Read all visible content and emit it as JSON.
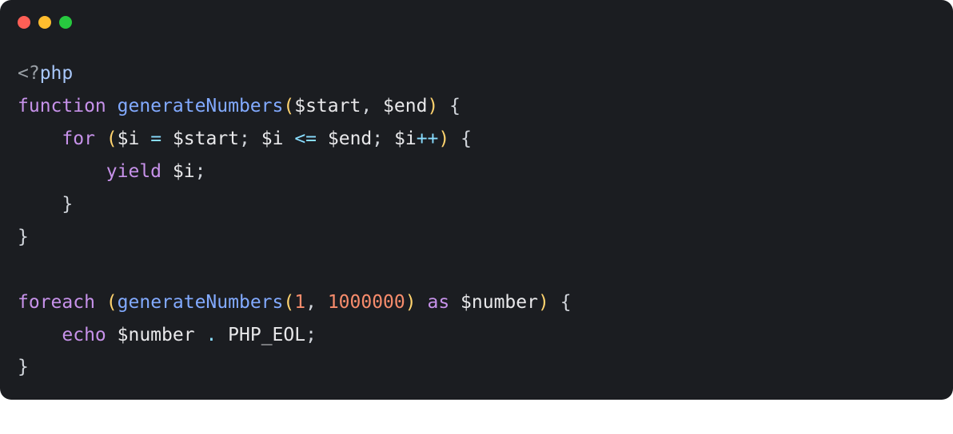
{
  "colors": {
    "background": "#1b1d21",
    "trafficRed": "#ff5f56",
    "trafficYellow": "#ffbd2e",
    "trafficGreen": "#27c93f"
  },
  "code": {
    "l1": {
      "open": "<?",
      "tag": "php"
    },
    "l2": {
      "kw": "function",
      "fn": "generateNumbers",
      "lp": "(",
      "v1": "$start",
      "c1": ",",
      "sp": " ",
      "v2": "$end",
      "rp": ")",
      "sp2": " ",
      "lb": "{"
    },
    "l3": {
      "indent": "    ",
      "kw": "for",
      "sp": " ",
      "lp": "(",
      "v1": "$i",
      "sp2": " ",
      "op1": "=",
      "sp3": " ",
      "v2": "$start",
      "sc1": ";",
      "sp4": " ",
      "v3": "$i",
      "sp5": " ",
      "op2": "<=",
      "sp6": " ",
      "v4": "$end",
      "sc2": ";",
      "sp7": " ",
      "v5": "$i",
      "op3": "++",
      "rp": ")",
      "sp8": " ",
      "lb": "{"
    },
    "l4": {
      "indent": "        ",
      "kw": "yield",
      "sp": " ",
      "v": "$i",
      "sc": ";"
    },
    "l5": {
      "indent": "    ",
      "rb": "}"
    },
    "l6": {
      "rb": "}"
    },
    "l7": {
      "blank": ""
    },
    "l8": {
      "kw1": "foreach",
      "sp1": " ",
      "lp": "(",
      "fn": "generateNumbers",
      "lp2": "(",
      "n1": "1",
      "c": ",",
      "sp2": " ",
      "n2": "1000000",
      "rp2": ")",
      "sp3": " ",
      "kw2": "as",
      "sp4": " ",
      "v": "$number",
      "rp": ")",
      "sp5": " ",
      "lb": "{"
    },
    "l9": {
      "indent": "    ",
      "kw": "echo",
      "sp": " ",
      "v": "$number",
      "sp2": " ",
      "op": ".",
      "sp3": " ",
      "const": "PHP_EOL",
      "sc": ";"
    },
    "l10": {
      "rb": "}"
    }
  }
}
